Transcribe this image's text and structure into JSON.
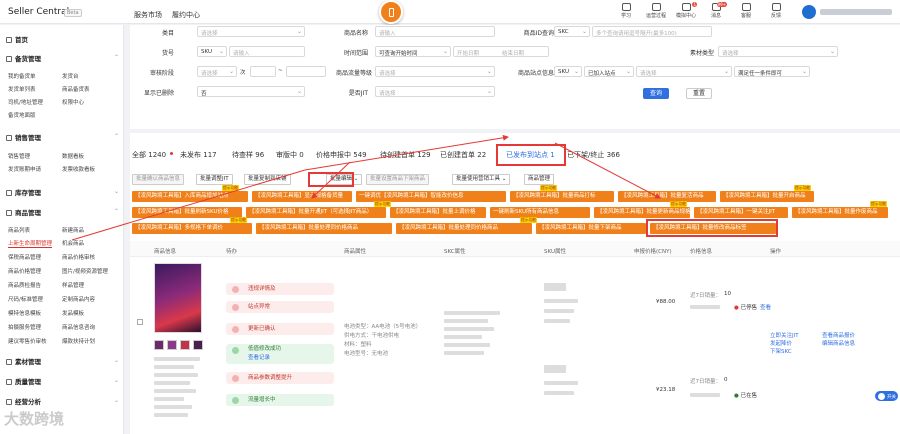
{
  "topbar": {
    "brand": "Seller Central",
    "beta": "Beta",
    "nav": [
      "服务市场",
      "履约中心"
    ],
    "tools": [
      {
        "label": "学习",
        "badge": ""
      },
      {
        "label": "运营过程",
        "badge": ""
      },
      {
        "label": "模拟中心",
        "badge": "1"
      },
      {
        "label": "消息",
        "badge": "99+"
      },
      {
        "label": "客服",
        "badge": ""
      },
      {
        "label": "反馈",
        "badge": ""
      }
    ]
  },
  "sidebar": {
    "home": "首页",
    "sections": [
      {
        "title": "备货管理",
        "items": [
          "我的备货单",
          "发货台",
          "发货单列表",
          "商品备货表",
          "司机/地址管理",
          "权限中心",
          "备货地面版"
        ]
      },
      {
        "title": "销售管理",
        "items": [
          "销售管理",
          "数据看板",
          "发货账期申请",
          "发票收款看板"
        ]
      },
      {
        "title": "库存管理",
        "items": []
      },
      {
        "title": "商品管理",
        "items": [
          "商品列表",
          "新建商品",
          "上新生命周期管理",
          "机会商品",
          "保税商品管理",
          "商品价格审核",
          "商品价格管理",
          "图片/视频资源管理",
          "商品质检报告",
          "样品管理",
          "尺码/标准管理",
          "定制商品内容",
          "模特信息模板",
          "发品模板",
          "拍摄服务管理",
          "商品信息咨询",
          "建议零售价审核",
          "爆款扶持计划"
        ]
      },
      {
        "title": "素材管理",
        "items": []
      },
      {
        "title": "质量管理",
        "items": []
      },
      {
        "title": "经营分析",
        "items": []
      }
    ],
    "watermark": "大数跨境"
  },
  "filters": {
    "row0": {
      "label": "类目",
      "ph": "请选择",
      "label2": "商品名称",
      "ph2": "请输入",
      "label3": "商品ID查询",
      "sel": "SKC",
      "ph3": "多个查询请用逗号隔开(最多100)"
    },
    "row1": {
      "label": "货号",
      "sel": "SKU",
      "ph": "请输入",
      "label2": "时间范围",
      "sel2": "可查询开始时间",
      "ph2a": "开始日期",
      "ph2b": "结束日期",
      "label3": "素材类型",
      "ph3": "请选择"
    },
    "row2": {
      "label": "审核阶段",
      "ph": "请选择",
      "sep": "次",
      "label2": "商品流量等级",
      "ph2": "请选择",
      "label3": "商品站点信息",
      "sel": "SKU",
      "sel2": "已加入站点",
      "ph3": "请选择",
      "sel3": "满足任一条件即可"
    },
    "row3": {
      "label": "显示已删除",
      "sel": "否",
      "label2": "是否JIT",
      "ph2": "请选择"
    },
    "query": "查询",
    "reset": "重置"
  },
  "tabs": [
    {
      "name": "全部",
      "count": "1240"
    },
    {
      "name": "未发布",
      "count": "117"
    },
    {
      "name": "待查样",
      "count": "96"
    },
    {
      "name": "审版中",
      "count": "0"
    },
    {
      "name": "价格申报中",
      "count": "549"
    },
    {
      "name": "待创建首单",
      "count": "129"
    },
    {
      "name": "已创建首单",
      "count": "22"
    },
    {
      "name": "已发布到站点",
      "count": "1"
    },
    {
      "name": "已下架/终止",
      "count": "366"
    }
  ],
  "actions": [
    "批量确认商品信息",
    "批量调整JIT",
    "批量复制到店铺",
    "批量编辑",
    "批量设置商品下架商品",
    "批量使用营销工具",
    "商品管理"
  ],
  "plugin_buttons": {
    "row1": [
      "【凌风跨境工具箱】入库商品增加站点",
      "【凌风跨境工具箱】显示规格备货量",
      "一键调优【凌风跨境工具箱】智能改价信息",
      "【凌风跨境工具箱】批量商品打标",
      "【凌风跨境工具箱】批量复活商品",
      "【凌风跨境工具箱】批量开启商品"
    ],
    "row2": [
      "【凌风跨境工具箱】批量刷新SKU价格",
      "【凌风跨境工具箱】批量开通JIT（可选择JIT商品）",
      "【凌风跨境工具箱】批量上调价格",
      "一键刷新SKU所有商品信息",
      "【凌风跨境工具箱】批量更新商品规格",
      "【凌风跨境工具箱】一键关注JIT",
      "【凌风跨境工具箱】批量作废商品"
    ],
    "row3": [
      "【凌风跨境工具箱】多规格下单调价",
      "【凌风跨境工具箱】批量处理同价格商品",
      "【凌风跨境工具箱】批量处理同价格商品",
      "【凌风跨境工具箱】批量下架商品",
      "【凌风跨境工具箱】批量修改商品标签"
    ],
    "new_badge": "提示功能"
  },
  "table": {
    "headers": [
      "商品信息",
      "待办",
      "商品属性",
      "SKC属性",
      "SKU属性",
      "申报价格(CNY)",
      "价格信息",
      "操作"
    ],
    "todos": [
      "违规详情及",
      "站点异常",
      "更新已确认",
      "低值修改成功",
      "商品参数调整提升",
      "流量增长中"
    ],
    "todo_sub": "查看记录",
    "attrs": [
      "电池类型：AA电池（5号电池）",
      "供电方式：干电池供电",
      "材料：塑料",
      "电池型号：无电池"
    ],
    "price1": "¥88.00",
    "price2": "¥23.18",
    "status": "已停售",
    "status2": "已在售",
    "sales_label": "近7日销量：",
    "sales_val": "10",
    "sales_label2": "近7日销量：",
    "sales_val2": "0",
    "view": "查看",
    "ops": [
      "立即关注JIT",
      "发起降价",
      "下架SKC",
      "查看商品报价",
      "编辑商品信息"
    ]
  },
  "toggle": "开关"
}
